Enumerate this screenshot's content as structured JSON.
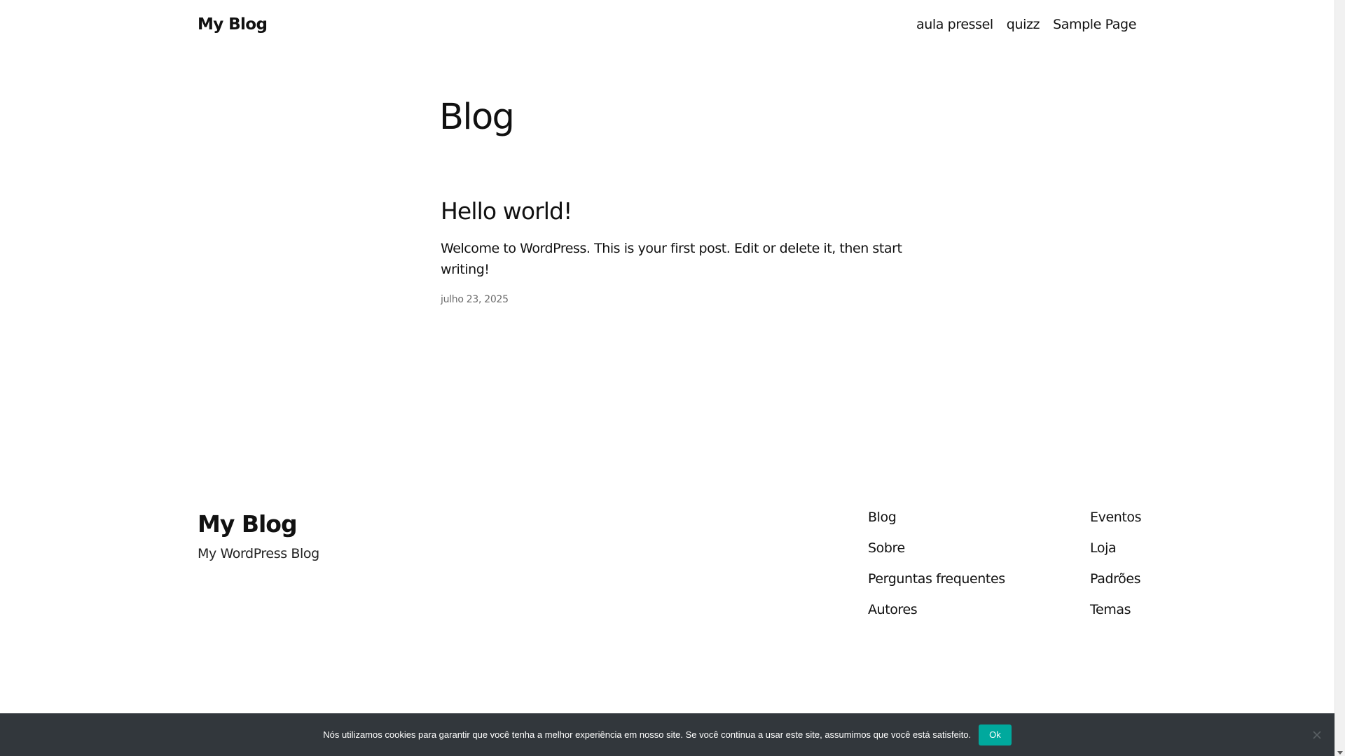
{
  "header": {
    "site_title": "My Blog",
    "nav": [
      {
        "label": "aula pressel"
      },
      {
        "label": "quizz"
      },
      {
        "label": "Sample Page"
      }
    ]
  },
  "main": {
    "page_title": "Blog",
    "posts": [
      {
        "title": "Hello world!",
        "excerpt": "Welcome to WordPress. This is your first post. Edit or delete it, then start writing!",
        "date": "julho 23, 2025"
      }
    ]
  },
  "footer": {
    "site_title": "My Blog",
    "tagline": "My WordPress Blog",
    "columns": [
      [
        {
          "label": "Blog"
        },
        {
          "label": "Sobre"
        },
        {
          "label": "Perguntas frequentes"
        },
        {
          "label": "Autores"
        }
      ],
      [
        {
          "label": "Eventos"
        },
        {
          "label": "Loja"
        },
        {
          "label": "Padrões"
        },
        {
          "label": "Temas"
        }
      ]
    ]
  },
  "cookie_notice": {
    "text": "Nós utilizamos cookies para garantir que você tenha a melhor experiência em nosso site. Se você continua a usar este site, assumimos que você está satisfeito.",
    "ok_label": "Ok",
    "close_icon": "close-icon",
    "background_color": "#32373c",
    "button_color": "#00a99d"
  }
}
